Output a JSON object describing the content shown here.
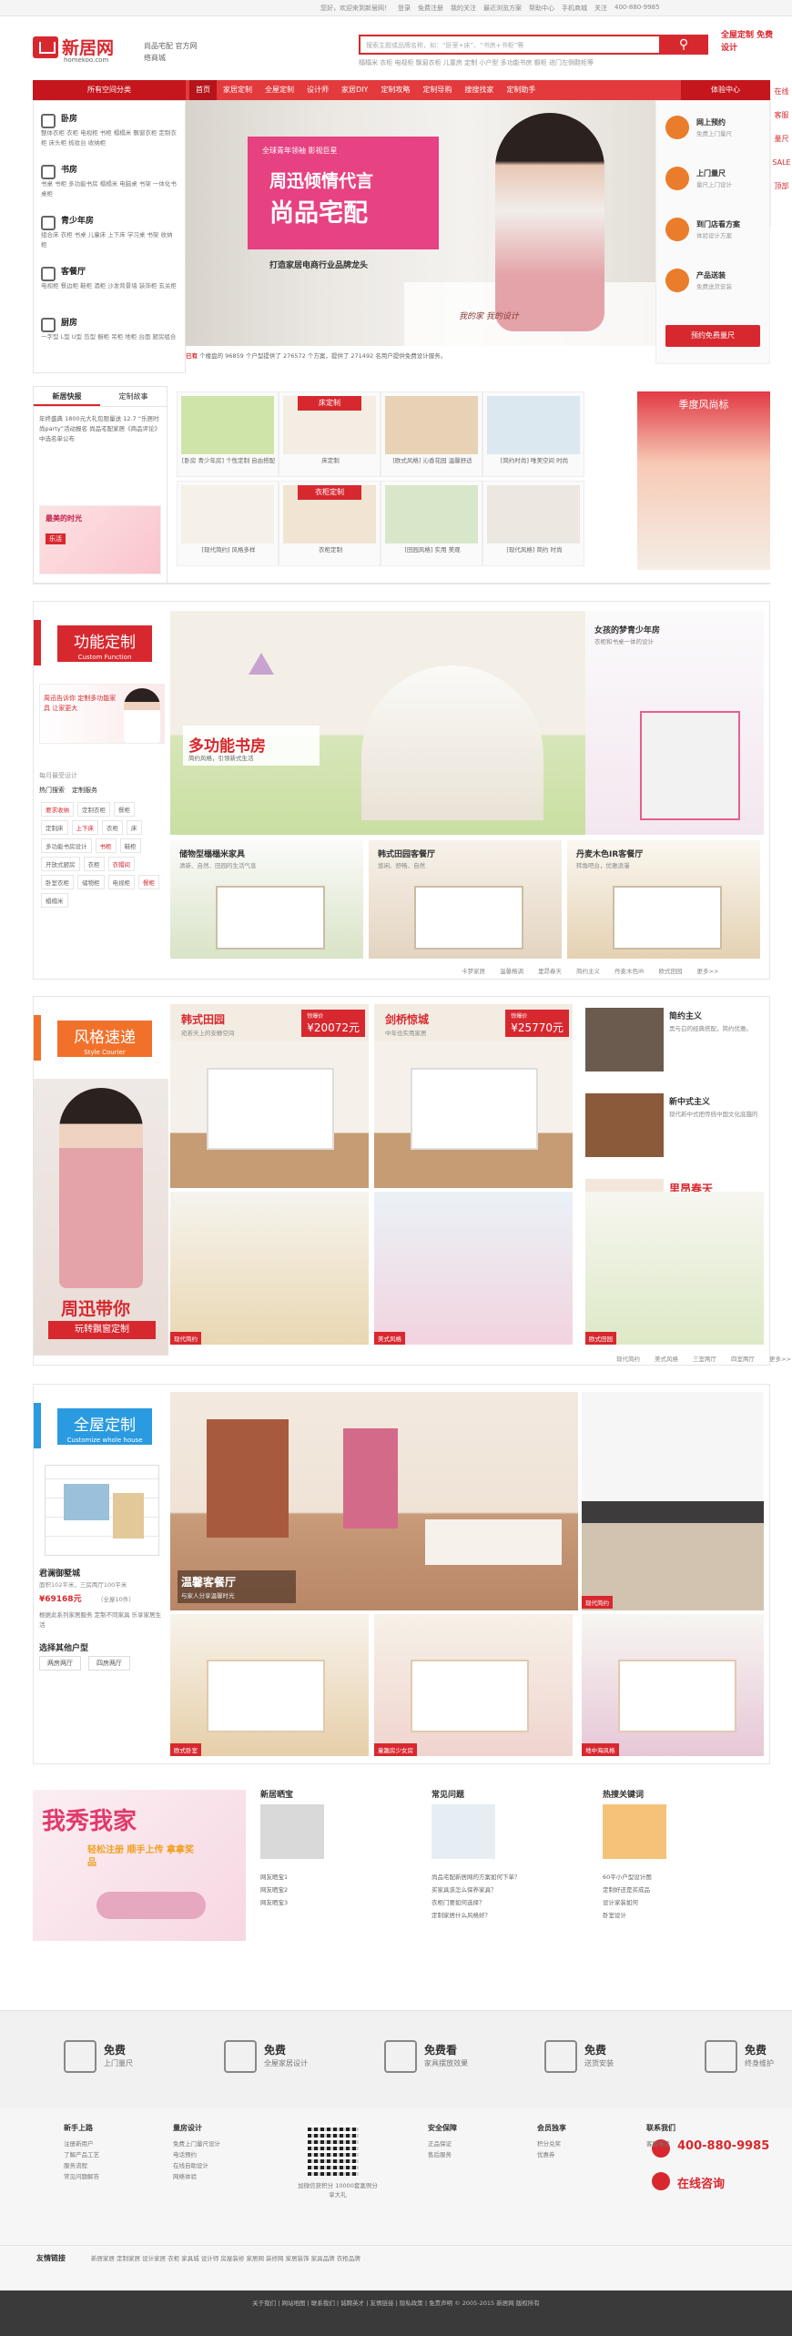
{
  "topbar": {
    "links": [
      "您好，欢迎来到新居网！",
      "登录",
      "免费注册",
      "我的关注",
      "最近浏览方案",
      "帮助中心",
      "手机商城",
      "关注",
      "400-880-9985"
    ]
  },
  "header": {
    "logo_text": "新居网",
    "logo_sub": "homekoo.com",
    "slogan": "尚品宅配 官方网络商城",
    "search_placeholder": "搜索主题或品牌名称，如：“卧室+床”、“书房+书柜”等",
    "hotwords": "榻榻米 衣柜 电视柜 飘窗衣柜 儿童房 定制 小户型 多功能书房 橱柜 进门左侧鞋柜等",
    "right_ad": "全屋定制 免费设计"
  },
  "nav": {
    "category": "所有空间分类",
    "items": [
      "首页",
      "家居定制",
      "全屋定制",
      "设计师",
      "家居DIY",
      "定制攻略",
      "定制导购",
      "搜搜找家",
      "定制助手"
    ],
    "experience": "体验中心"
  },
  "sidecat": [
    {
      "title": "卧房",
      "sub": "整体衣柜 衣柜 电视柜 书柜 榻榻米 飘窗衣柜 定制衣柜 床头柜 梳妆台 收纳柜"
    },
    {
      "title": "书房",
      "sub": "书桌 书柜 多功能书房 榻榻米 电脑桌 书架 一体化书桌柜"
    },
    {
      "title": "青少年房",
      "sub": "组合床 衣柜 书桌 儿童床 上下床 学习桌 书架 收纳柜"
    },
    {
      "title": "客餐厅",
      "sub": "电视柜 餐边柜 鞋柜 酒柜 沙发背景墙 装饰柜 玄关柜"
    },
    {
      "title": "厨房",
      "sub": "一字型 L型 U型 岛型 橱柜 吊柜 地柜 台面 厨房组合"
    }
  ],
  "banner": {
    "tag": "全球青年领袖  影视巨星",
    "title1": "周迅倾情代言",
    "title2": "尚品宅配",
    "subtitle": "打造家居电商行业品牌龙头",
    "signature": "我的家 我的设计"
  },
  "ticker": {
    "prefix": "已有",
    "text": "个楼盘的 96859 个户型提供了 276572 个方案，提供了 271492 名用户提供免费设计服务。"
  },
  "rpanel": {
    "items": [
      {
        "t": "网上预约",
        "s": "免费上门量尺"
      },
      {
        "t": "上门量尺",
        "s": "量尺上门设计"
      },
      {
        "t": "到门店看方案",
        "s": "体验设计方案"
      },
      {
        "t": "产品送装",
        "s": "免费送货安装"
      }
    ],
    "button": "预约免费量尺"
  },
  "fixright": [
    "在线",
    "客服",
    "量尺",
    "SALE",
    "顶部"
  ],
  "news": {
    "tabs": [
      "新居快报",
      "定制故事"
    ],
    "text": "年终盛典 1800元大礼包限量送 12.7 “乐居时尚party”活动报名 尚品宅配家居《商品评论》中选名单公布",
    "mini_title": "最美的时光",
    "mini_tag": "乐活"
  },
  "gallery": [
    {
      "cap": "[卧房 青少年房] 个性定制 自由搭配"
    },
    {
      "cap": "床定制",
      "tag": "床定制"
    },
    {
      "cap": "[欧式风格] 沁香花园 温馨舒适"
    },
    {
      "cap": "[简约时尚] 唯美空间 时尚"
    },
    {
      "cap": "[现代简约] 风格多样"
    },
    {
      "cap": "衣柜定制",
      "tag": "衣柜定制"
    },
    {
      "cap": "[田园风格] 实用 美观"
    },
    {
      "cap": "[现代风格] 简约 时尚"
    }
  ],
  "season": {
    "title": "季度风尚标"
  },
  "section1": {
    "title": "功能定制",
    "en": "Custom Function",
    "promo": "周迅告诉你 定制多功能家具 让家更大",
    "hot_title": "每月最受设计",
    "hot_tabs": [
      "热门搜索",
      "定制服务"
    ],
    "tags": [
      "要求收纳",
      "定制衣柜",
      "餐柜",
      "定制床",
      "上下床",
      "衣柜",
      "床",
      "多功能书房设计",
      "书柜",
      "鞋柜",
      "开放式厨房",
      "衣柜",
      "衣帽间",
      "卧室衣柜",
      "储物柜",
      "电视柜",
      "餐柜",
      "榻榻米"
    ],
    "main": {
      "t": "多功能书房",
      "s": "简约风格，引领新式生活"
    },
    "side": {
      "t": "女孩的梦青少年房",
      "s": "衣柜和书桌一体的设计"
    },
    "cards": [
      {
        "t": "储物型榻榻米家具",
        "s": "清新、自然、田园的生活气息"
      },
      {
        "t": "韩式田园客餐厅",
        "s": "悠闲、舒畅、自然"
      },
      {
        "t": "丹麦木色IR客餐厅",
        "s": "转角吧台，优雅浪漫"
      }
    ],
    "bottom": [
      "卡梦家居",
      "温馨格调",
      "里昂春天",
      "简约主义",
      "丹麦木色IR",
      "欧式田园",
      "更多>>"
    ]
  },
  "section2": {
    "title": "风格速递",
    "en": "Style Courier",
    "promo1": "周迅带你",
    "promo2": "玩转飘窗定制",
    "cards": [
      {
        "t": "韩式田园",
        "s": "宛若天上的安静空间",
        "p": "¥20072元",
        "pl": "惊爆价"
      },
      {
        "t": "剑桥惊城",
        "s": "中年也实用家居",
        "p": "¥25770元",
        "pl": "惊爆价"
      }
    ],
    "right": [
      {
        "t": "简约主义",
        "s": "黑与白的经典搭配，简约优雅。"
      },
      {
        "t": "新中式主义",
        "s": "现代新中式把传统中国文化底蕴的"
      },
      {
        "t": "里昂春天",
        "s": "馨香之家，浪漫"
      }
    ],
    "captions": [
      "现代简约",
      "美式风格",
      "现代简约",
      "里昂春天",
      "欧式田园"
    ],
    "bottom": [
      "现代简约",
      "美式风格",
      "三室两厅",
      "四室两厅",
      "更多>>"
    ]
  },
  "section3": {
    "title": "全屋定制",
    "en": "Customize whole house",
    "plan_title": "君澜御墅城",
    "plan_sub": "面积102平米，三房两厅100平米",
    "plan_price": "¥69168元",
    "plan_note": "（全屋10件）",
    "plan_desc": "根据此系列家居服务 定制不同家具 乐享家居生活",
    "select": "选择其他户型",
    "select_opts": [
      "两房两厅",
      "四房两厅"
    ],
    "main": "温馨客餐厅",
    "main_sub": "与家人分享温馨时光",
    "captions": [
      "欧式卧室",
      "童趣房少女房",
      "地中海风格",
      "现代简约"
    ]
  },
  "section4": {
    "banner": "我秀我家",
    "banner_sub": "轻松注册 顺手上传 拿拿奖品",
    "cols": [
      {
        "h": "新居晒宝",
        "items": [
          "网友晒宝1",
          "网友晒宝2",
          "网友晒宝3"
        ]
      },
      {
        "h": "常见问题",
        "items": [
          "尚品宅配新居网的方案如何下单？",
          "买家具该怎么保养家具？",
          "衣柜门要如何选择？",
          "定制家居什么风格好？"
        ]
      },
      {
        "h": "热搜关键词",
        "items": [
          "60平小户型设计图",
          "定制好还是买成品",
          "设计家装如何",
          "卧室设计"
        ]
      }
    ]
  },
  "features": [
    {
      "t": "免费",
      "s": "上门量尺"
    },
    {
      "t": "免费",
      "s": "全屋家居设计"
    },
    {
      "t": "免费看",
      "s": "家具摆放效果"
    },
    {
      "t": "免费",
      "s": "送货安装"
    },
    {
      "t": "免费",
      "s": "终身维护"
    }
  ],
  "footer": {
    "cols": [
      {
        "h": "新手上路",
        "l": [
          "注册新用户",
          "了解产品工艺",
          "服务流程",
          "常见问题解答"
        ]
      },
      {
        "h": "量房设计",
        "l": [
          "免费上门量尺设计",
          "电话预约",
          "在线自助设计",
          "网络体验"
        ]
      },
      {
        "h": "安全保障",
        "l": [
          "正品保证",
          "售后服务"
        ]
      },
      {
        "h": "会员独享",
        "l": [
          "积分兑奖",
          "优惠券"
        ]
      },
      {
        "h": "联系我们",
        "l": [
          "客服电话"
        ]
      }
    ],
    "qr_caption": "加微信获积分 10000套案例分享大礼",
    "hotline": "400-880-9985",
    "online": "在线咨询",
    "friend_h": "友情链接",
    "friend": "新居家居 定制家居 设计家居 衣柜 家具城 设计师 房屋装修 家居网 装修网 家居装饰 家具品牌 衣柜品牌",
    "copy": "关于我们 | 网站地图 | 联系我们 | 诚聘英才 | 友情链接 | 隐私政策 | 免责声明 © 2005-2015 新居网 版权所有"
  }
}
